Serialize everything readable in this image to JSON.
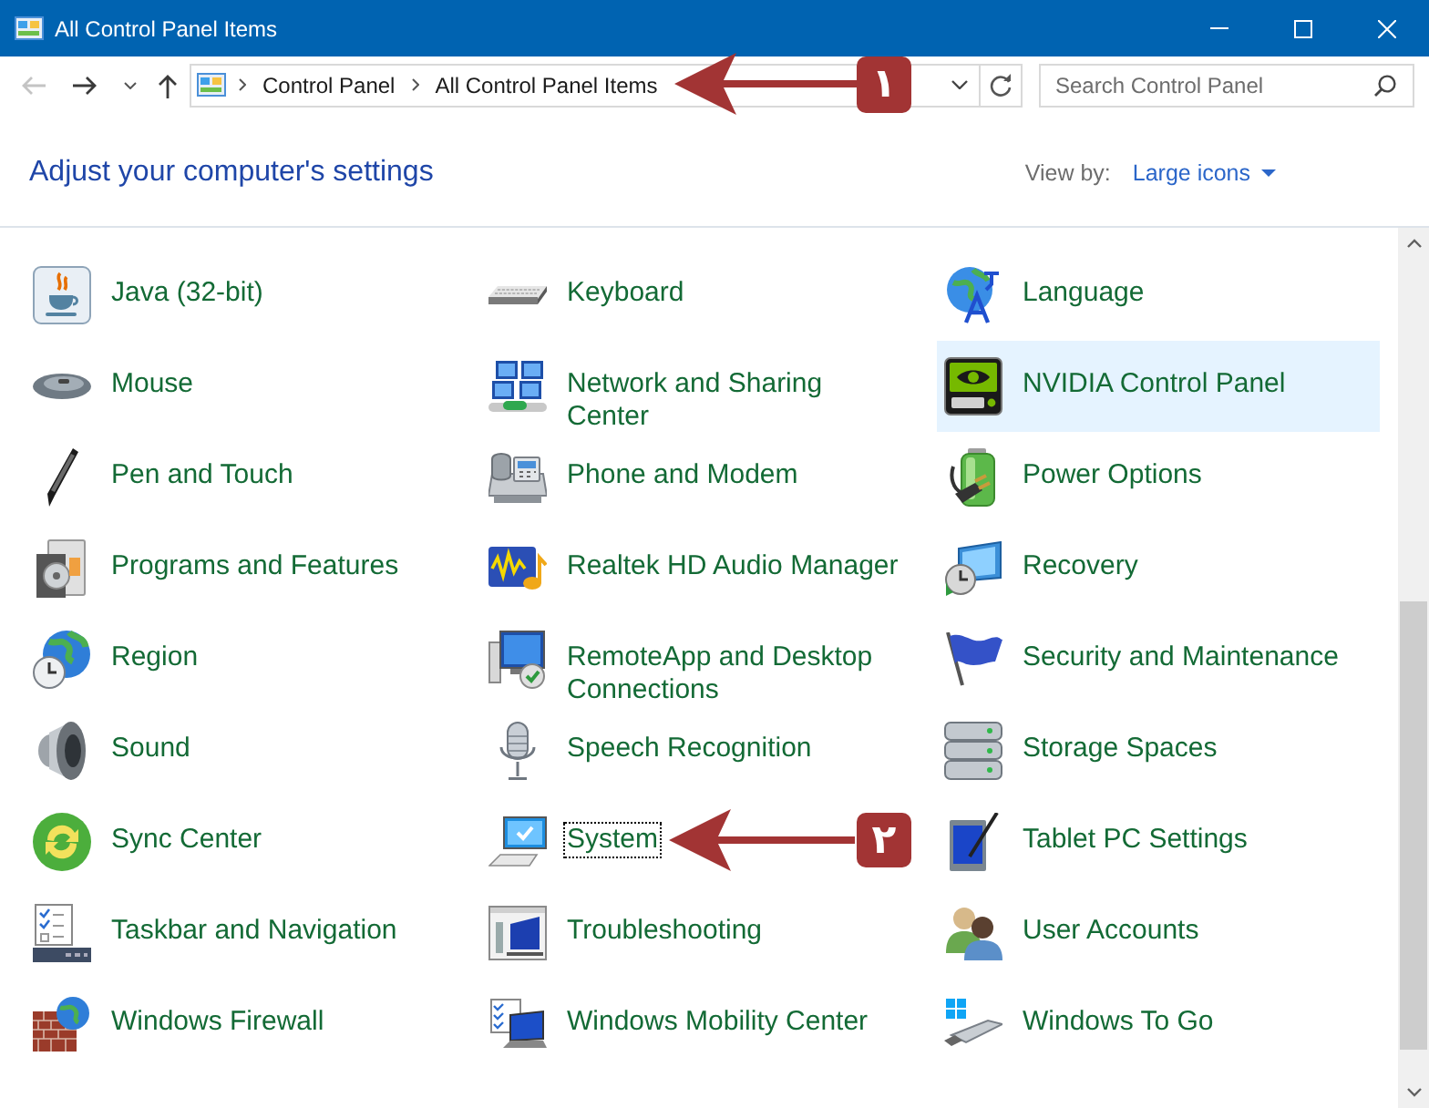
{
  "window": {
    "title": "All Control Panel Items"
  },
  "navigation": {
    "back": {
      "disabled": true
    },
    "forward": {
      "disabled": false
    }
  },
  "address_bar": {
    "breadcrumbs": [
      "Control Panel",
      "All Control Panel Items"
    ]
  },
  "search": {
    "placeholder": "Search Control Panel"
  },
  "header": {
    "title": "Adjust your computer's settings",
    "view_by_label": "View by:",
    "view_by_value": "Large icons"
  },
  "items": [
    {
      "kind": "java",
      "label": "Java (32-bit)",
      "highlighted": false,
      "focused": false
    },
    {
      "kind": "keyboard",
      "label": "Keyboard",
      "highlighted": false,
      "focused": false
    },
    {
      "kind": "language",
      "label": "Language",
      "highlighted": false,
      "focused": false
    },
    {
      "kind": "mouse",
      "label": "Mouse",
      "highlighted": false,
      "focused": false
    },
    {
      "kind": "network",
      "label": "Network and Sharing Center",
      "highlighted": false,
      "focused": false
    },
    {
      "kind": "nvidia",
      "label": "NVIDIA Control Panel",
      "highlighted": true,
      "focused": false
    },
    {
      "kind": "pen",
      "label": "Pen and Touch",
      "highlighted": false,
      "focused": false
    },
    {
      "kind": "phone",
      "label": "Phone and Modem",
      "highlighted": false,
      "focused": false
    },
    {
      "kind": "power",
      "label": "Power Options",
      "highlighted": false,
      "focused": false
    },
    {
      "kind": "programs",
      "label": "Programs and Features",
      "highlighted": false,
      "focused": false
    },
    {
      "kind": "realtek",
      "label": "Realtek HD Audio Manager",
      "highlighted": false,
      "focused": false
    },
    {
      "kind": "recovery",
      "label": "Recovery",
      "highlighted": false,
      "focused": false
    },
    {
      "kind": "region",
      "label": "Region",
      "highlighted": false,
      "focused": false
    },
    {
      "kind": "remoteapp",
      "label": "RemoteApp and Desktop Connections",
      "highlighted": false,
      "focused": false
    },
    {
      "kind": "security",
      "label": "Security and Maintenance",
      "highlighted": false,
      "focused": false
    },
    {
      "kind": "sound",
      "label": "Sound",
      "highlighted": false,
      "focused": false
    },
    {
      "kind": "speech",
      "label": "Speech Recognition",
      "highlighted": false,
      "focused": false
    },
    {
      "kind": "storage",
      "label": "Storage Spaces",
      "highlighted": false,
      "focused": false
    },
    {
      "kind": "sync",
      "label": "Sync Center",
      "highlighted": false,
      "focused": false
    },
    {
      "kind": "system",
      "label": "System",
      "highlighted": false,
      "focused": true
    },
    {
      "kind": "tablet",
      "label": "Tablet PC Settings",
      "highlighted": false,
      "focused": false
    },
    {
      "kind": "taskbar",
      "label": "Taskbar and Navigation",
      "highlighted": false,
      "focused": false
    },
    {
      "kind": "troubleshooting",
      "label": "Troubleshooting",
      "highlighted": false,
      "focused": false
    },
    {
      "kind": "users",
      "label": "User Accounts",
      "highlighted": false,
      "focused": false
    },
    {
      "kind": "firewall",
      "label": "Windows Firewall",
      "highlighted": false,
      "focused": false
    },
    {
      "kind": "mobility",
      "label": "Windows Mobility Center",
      "highlighted": false,
      "focused": false
    },
    {
      "kind": "windowstogo",
      "label": "Windows To Go",
      "highlighted": false,
      "focused": false
    }
  ],
  "annotations": [
    {
      "label": "۱"
    },
    {
      "label": "۲"
    }
  ]
}
